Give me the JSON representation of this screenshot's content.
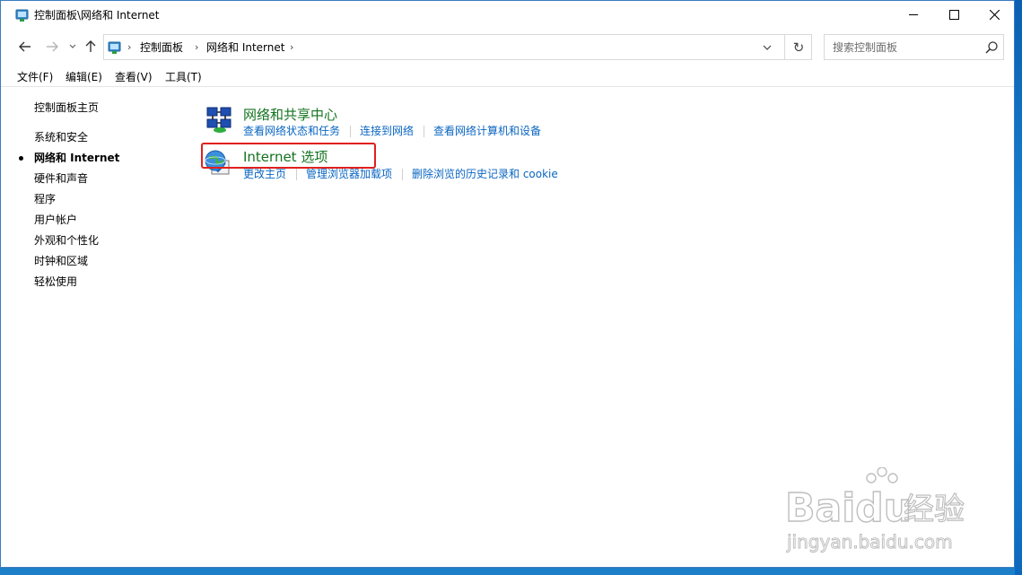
{
  "window": {
    "title": "控制面板\\网络和 Internet",
    "controls": {
      "minimize": "minimize",
      "maximize": "maximize",
      "close": "close"
    }
  },
  "address_bar": {
    "crumbs": [
      "控制面板",
      "网络和 Internet"
    ]
  },
  "search": {
    "placeholder": "搜索控制面板"
  },
  "menu": [
    {
      "label": "文件(F)"
    },
    {
      "label": "编辑(E)"
    },
    {
      "label": "查看(V)"
    },
    {
      "label": "工具(T)"
    }
  ],
  "sidebar": {
    "home": "控制面板主页",
    "items": [
      {
        "label": "系统和安全",
        "active": false
      },
      {
        "label": "网络和 Internet",
        "active": true
      },
      {
        "label": "硬件和声音",
        "active": false
      },
      {
        "label": "程序",
        "active": false
      },
      {
        "label": "用户帐户",
        "active": false
      },
      {
        "label": "外观和个性化",
        "active": false
      },
      {
        "label": "时钟和区域",
        "active": false
      },
      {
        "label": "轻松使用",
        "active": false
      }
    ]
  },
  "categories": [
    {
      "title": "网络和共享中心",
      "icon": "network-sharing-icon",
      "links": [
        "查看网络状态和任务",
        "连接到网络",
        "查看网络计算机和设备"
      ]
    },
    {
      "title": "Internet 选项",
      "icon": "internet-options-icon",
      "links": [
        "更改主页",
        "管理浏览器加载项",
        "删除浏览的历史记录和 cookie"
      ]
    }
  ],
  "colors": {
    "category_title": "#13731f",
    "link": "#0a66c2",
    "highlight": "#e0201c",
    "desktop": "#1e7fc9"
  },
  "watermark": {
    "brand": "Baidu",
    "brand_cn": "经验",
    "url": "jingyan.baidu.com"
  }
}
